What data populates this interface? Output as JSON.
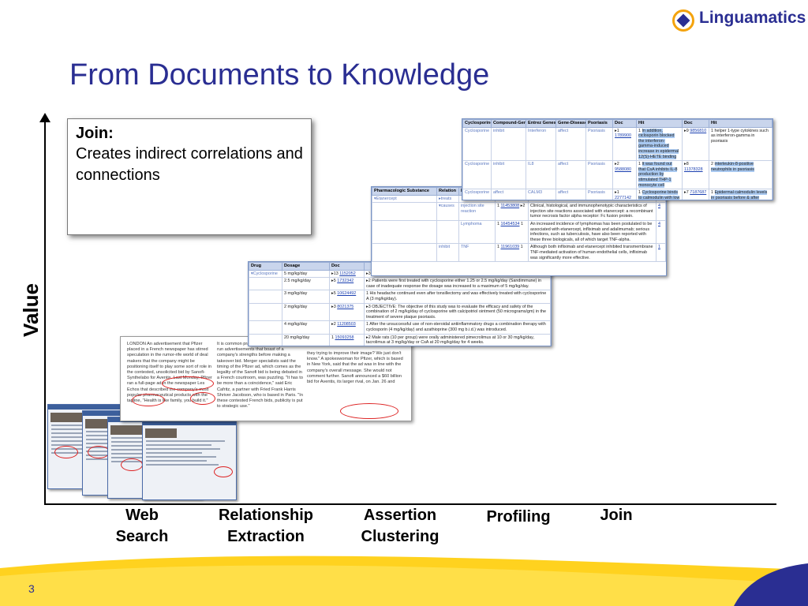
{
  "title": "From Documents to Knowledge",
  "logo_text": "Linguamatics",
  "page_number": "3",
  "y_axis_label": "Value",
  "stages": [
    {
      "line1": "Web",
      "line2": "Search"
    },
    {
      "line1": "Relationship",
      "line2": "Extraction"
    },
    {
      "line1": "Assertion",
      "line2": "Clustering"
    },
    {
      "line1": "Profiling",
      "line2": ""
    },
    {
      "line1": "Join",
      "line2": ""
    }
  ],
  "callout": {
    "heading": "Join:",
    "body": "Creates indirect correlations and connections"
  },
  "colors": {
    "brand_blue": "#2a2e92",
    "brand_orange": "#f4a30d",
    "highlight": "#a8c8f0"
  },
  "article": {
    "col1": "LONDON An advertisement that Pfizer placed in a French newspaper has stirred speculation in the rumor-rife world of deal makers that the company might be positioning itself to play some sort of role in the contested, unsolicited bid by Sanofi-Synthelabo for Aventis. Last Monday, Pfizer ran a full-page ad in the newspaper Les Echos that described the company's most popular pharmaceutical products with the tagline, \"Health is like family, you build it.\"",
    "col2": "It is common practice for drug companies to run advertisements that boast of a company's strengths before making a takeover bid. Merger specialists said the timing of the Pfizer ad, which comes as the legality of the Sanofi bid is being debated in a French courtroom, was puzzling. \"It has to be more than a coincidence,\" said Eric Cafritz, a partner with Fried Frank Harris Shriver Jacobson, who is based in Paris. \"In these contested French bids, publicity is put to strategic use.\"",
    "col3": "they trying to improve their image? We just don't know.\" A spokeswoman for Pfizer, which is based in New York, said that the ad was in line with the company's overall message. She would not comment further. Sanofi announced a $60 billion bid for Aventis, its larger rival, on Jan. 26 and"
  },
  "table_drug": {
    "headers": [
      "Drug",
      "Dosage",
      "Doc",
      ""
    ],
    "rows": [
      {
        "drug": "Cyclosporine",
        "dosage": "5 mg/kg/day",
        "count": "13",
        "pmid": "1152052",
        "n": "3",
        "text": ""
      },
      {
        "drug": "",
        "dosage": "2.5 mg/kg/day",
        "count": "5",
        "pmid": "1732342",
        "n": "2",
        "text": "Patients were first treated with cyclosporine either 1.25 or 2.5 mg/kg/day (Sandimmune) in case of inadequate response the dosage was increased to a maximum of 5 mg/kg/day."
      },
      {
        "drug": "",
        "dosage": "3 mg/kg/day",
        "count": "5",
        "pmid": "10624492",
        "n": "1",
        "text": "His headache continued even after tonsillectomy and was effectively treated with cyclosporine A (3 mg/kg/day)."
      },
      {
        "drug": "",
        "dosage": "2 mg/kg/day",
        "count": "3",
        "pmid": "8021375",
        "n": "3",
        "text": "OBJECTIVE: The objective of this study was to evaluate the efficacy and safety of the combination of 2 mg/kg/day of cyclosporine with calcipotriol ointment (50 micrograms/gm) in the treatment of severe plaque psoriasis."
      },
      {
        "drug": "",
        "dosage": "4 mg/kg/day",
        "count": "2",
        "pmid": "11208503",
        "n": "1",
        "text": "After the unsuccessful use of non-steroidal antiinflammatory drugs a combination therapy with cyclosporin (4 mg/kg/day) and azathioprine (300 mg b.i.d.) was introduced."
      },
      {
        "drug": "",
        "dosage": "20 mg/kg/day",
        "count": "1",
        "pmid": "15093258",
        "n": "2",
        "text": "Male rats (10 per group) were orally administered pimecrolimus at 10 or 30 mg/kg/day, tacrolimus at 3 mg/kg/day or CsA at 20 mg/kg/day for 4 weeks."
      }
    ]
  },
  "table_pharma": {
    "headers": [
      "Pharmacologic Substance",
      "Relation",
      "E"
    ],
    "rows": [
      {
        "substance": "Etanercept",
        "relation": "treats",
        "target": "",
        "count": "",
        "pmid": "",
        "n": "",
        "text": "",
        "doc": ""
      },
      {
        "substance": "",
        "relation": "causes",
        "target": "injection site reaction",
        "count": "1",
        "pmid": "11453808",
        "n": "2",
        "text": "Clinical, histological, and immunophenotypic characteristics of injection site reactions associated with etanercept: a recombinant tumor necrosis factor alpha receptor: Fc fusion protein.",
        "doc": "4"
      },
      {
        "substance": "",
        "relation": "",
        "target": "Lymphoma",
        "count": "1",
        "pmid": "16454534",
        "n": "1",
        "text": "An increased incidence of lymphomas has been postulated to be associated with etanercept, infliximab and adalimumab; serious infections, such as tuberculosis, have also been reported with these three biologicals, all of which target TNF-alpha.",
        "doc": "4"
      },
      {
        "substance": "",
        "relation": "inhibit",
        "target": "TNF",
        "count": "1",
        "pmid": "11961039",
        "n": "1",
        "text": "Although both infliximab and etanercept inhibited transmembrane TNF-mediated activation of human endothelial cells, infliximab was significantly more effective.",
        "doc": "1"
      }
    ]
  },
  "table_cyclo": {
    "headers": [
      "Cyclosporine",
      "Compound-Gene",
      "Entrez Genes",
      "Gene-Disease",
      "Psoriasis",
      "Doc",
      "Hit",
      "Doc",
      "Hit"
    ],
    "rows": [
      {
        "a": "Cyclosporine",
        "b": "inhibit",
        "c": "Interferon",
        "d": "affect",
        "e": "Psoriasis",
        "count1": "1",
        "pmid1": "1789900",
        "n1": "1",
        "hit1": "In addition, ciclosporin blocked the interferon-gamma-induced increase in epidermal 12(S)-HETE binding",
        "count2": "9",
        "pmid2": "9856810",
        "n2": "1",
        "hit2": "helper 1-type cytokines such as interferon-gamma in psoriasis"
      },
      {
        "a": "Cyclosporine",
        "b": "inhibit",
        "c": "IL8",
        "d": "affect",
        "e": "Psoriasis",
        "count1": "2",
        "pmid1": "9588080",
        "n1": "1",
        "hit1": "It was found out that CsA inhibits IL-8 production by stimulated THP-1 monocyte cell",
        "count2": "8",
        "pmid2": "11378328",
        "n2": "2",
        "hit2": "interleukin-8-positive neutrophils in psoriasis"
      },
      {
        "a": "Cyclosporine",
        "b": "affect",
        "c": "CALM3",
        "d": "affect",
        "e": "Psoriasis",
        "count1": "1",
        "pmid1": "2277142",
        "n1": "1",
        "hit1": "Cyclosporine binds to calmodulin with low affinity, and",
        "count2": "7",
        "pmid2": "7187687",
        "n2": "1",
        "hit2": "Epidermal calmodulin levels in psoriasis before & after therapy"
      }
    ]
  }
}
